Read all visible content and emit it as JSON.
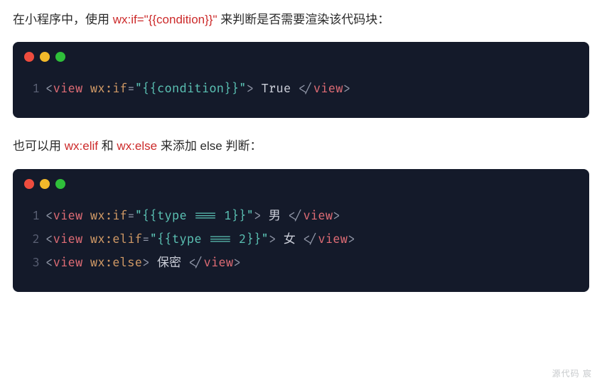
{
  "para1": {
    "pre": "在小程序中，使用 ",
    "code": "wx:if=\"{{condition}}\"",
    "post": " 来判断是否需要渲染该代码块："
  },
  "code1": {
    "lines": [
      {
        "n": "1",
        "tokens": [
          {
            "cls": "pun",
            "t": "<"
          },
          {
            "cls": "tag",
            "t": "view"
          },
          {
            "cls": "txt",
            "t": " "
          },
          {
            "cls": "attr",
            "t": "wx:if"
          },
          {
            "cls": "pun",
            "t": "="
          },
          {
            "cls": "str",
            "t": "\"{{condition}}\""
          },
          {
            "cls": "pun",
            "t": ">"
          },
          {
            "cls": "txt",
            "t": " True "
          },
          {
            "cls": "pun",
            "t": "</"
          },
          {
            "cls": "tag",
            "t": "view"
          },
          {
            "cls": "pun",
            "t": ">"
          }
        ]
      }
    ]
  },
  "para2": {
    "pre": "也可以用 ",
    "code1": "wx:elif",
    "mid": " 和 ",
    "code2": "wx:else",
    "post": " 来添加 else 判断："
  },
  "code2": {
    "lines": [
      {
        "n": "1",
        "tokens": [
          {
            "cls": "pun",
            "t": "<"
          },
          {
            "cls": "tag",
            "t": "view"
          },
          {
            "cls": "txt",
            "t": " "
          },
          {
            "cls": "attr",
            "t": "wx:if"
          },
          {
            "cls": "pun",
            "t": "="
          },
          {
            "cls": "str",
            "t": "\"{{type === 1}}\""
          },
          {
            "cls": "pun",
            "t": ">"
          },
          {
            "cls": "txt",
            "t": " 男 "
          },
          {
            "cls": "pun",
            "t": "</"
          },
          {
            "cls": "tag",
            "t": "view"
          },
          {
            "cls": "pun",
            "t": ">"
          }
        ]
      },
      {
        "n": "2",
        "tokens": [
          {
            "cls": "pun",
            "t": "<"
          },
          {
            "cls": "tag",
            "t": "view"
          },
          {
            "cls": "txt",
            "t": " "
          },
          {
            "cls": "attr",
            "t": "wx:elif"
          },
          {
            "cls": "pun",
            "t": "="
          },
          {
            "cls": "str",
            "t": "\"{{type === 2}}\""
          },
          {
            "cls": "pun",
            "t": ">"
          },
          {
            "cls": "txt",
            "t": " 女 "
          },
          {
            "cls": "pun",
            "t": "</"
          },
          {
            "cls": "tag",
            "t": "view"
          },
          {
            "cls": "pun",
            "t": ">"
          }
        ]
      },
      {
        "n": "3",
        "tokens": [
          {
            "cls": "pun",
            "t": "<"
          },
          {
            "cls": "tag",
            "t": "view"
          },
          {
            "cls": "txt",
            "t": " "
          },
          {
            "cls": "attr",
            "t": "wx:else"
          },
          {
            "cls": "pun",
            "t": ">"
          },
          {
            "cls": "txt",
            "t": " 保密 "
          },
          {
            "cls": "pun",
            "t": "</"
          },
          {
            "cls": "tag",
            "t": "view"
          },
          {
            "cls": "pun",
            "t": ">"
          }
        ]
      }
    ]
  },
  "watermark": "源代码   宸"
}
